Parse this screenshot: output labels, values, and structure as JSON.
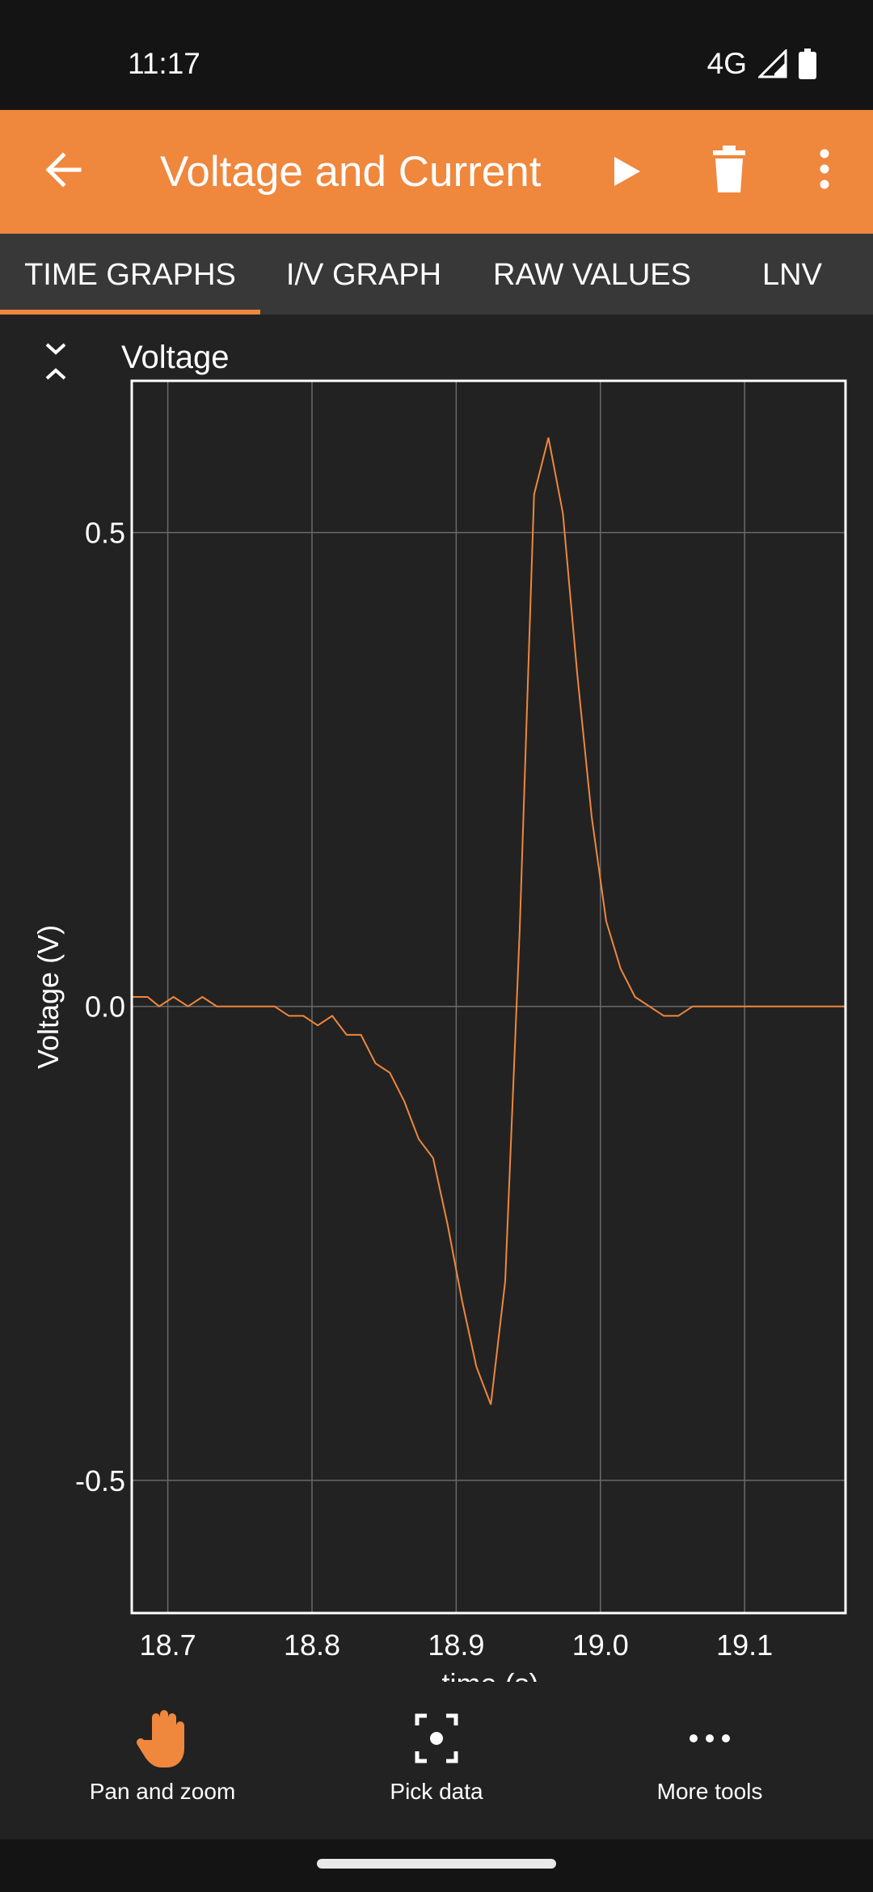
{
  "status_bar": {
    "time": "11:17",
    "network": "4G"
  },
  "app_bar": {
    "title": "Voltage and Current",
    "back_icon": "arrow-back-icon",
    "play_icon": "play-icon",
    "delete_icon": "trash-icon",
    "overflow_icon": "more-vert-icon"
  },
  "tabs": [
    {
      "label": "TIME GRAPHS",
      "active": true
    },
    {
      "label": "I/V GRAPH",
      "active": false
    },
    {
      "label": "RAW VALUES",
      "active": false
    },
    {
      "label": "LNV",
      "active": false
    }
  ],
  "graph": {
    "title": "Voltage",
    "collapse_icon": "collapse-icon"
  },
  "chart_data": {
    "type": "line",
    "xlabel": "time (s)",
    "ylabel": "Voltage (V)",
    "xlim": [
      18.675,
      19.17
    ],
    "ylim": [
      -0.64,
      0.66
    ],
    "x_ticks": [
      "18.7",
      "18.8",
      "18.9",
      "19.0",
      "19.1"
    ],
    "y_ticks": [
      "0.5",
      "0.0",
      "-0.5"
    ],
    "grid": true,
    "line_color": "#EF873D",
    "series": [
      {
        "x": [
          18.675,
          18.686,
          18.694,
          18.704,
          18.714,
          18.724,
          18.734,
          18.744,
          18.754,
          18.764,
          18.774,
          18.784,
          18.794,
          18.804,
          18.814,
          18.824,
          18.834,
          18.844,
          18.854,
          18.864,
          18.874,
          18.884,
          18.894,
          18.904,
          18.914,
          18.924,
          18.934,
          18.944,
          18.954,
          18.964,
          18.974,
          18.984,
          18.994,
          19.004,
          19.014,
          19.024,
          19.034,
          19.044,
          19.054,
          19.064,
          19.074,
          19.084,
          19.094,
          19.104,
          19.114,
          19.124,
          19.134,
          19.144,
          19.154,
          19.17
        ],
        "y": [
          0.01,
          0.01,
          0.0,
          0.01,
          0.0,
          0.01,
          0.0,
          0.0,
          0.0,
          0.0,
          0.0,
          -0.01,
          -0.01,
          -0.02,
          -0.01,
          -0.03,
          -0.03,
          -0.06,
          -0.07,
          -0.1,
          -0.14,
          -0.16,
          -0.23,
          -0.31,
          -0.38,
          -0.42,
          -0.29,
          0.08,
          0.54,
          0.6,
          0.52,
          0.35,
          0.2,
          0.09,
          0.04,
          0.01,
          0.0,
          -0.01,
          -0.01,
          0.0,
          0.0,
          0.0,
          0.0,
          0.0,
          0.0,
          0.0,
          0.0,
          0.0,
          0.0,
          0.0
        ]
      }
    ]
  },
  "tools": [
    {
      "label": "Pan and zoom",
      "icon": "hand-icon"
    },
    {
      "label": "Pick data",
      "icon": "focus-point-icon"
    },
    {
      "label": "More tools",
      "icon": "more-horiz-icon"
    }
  ]
}
